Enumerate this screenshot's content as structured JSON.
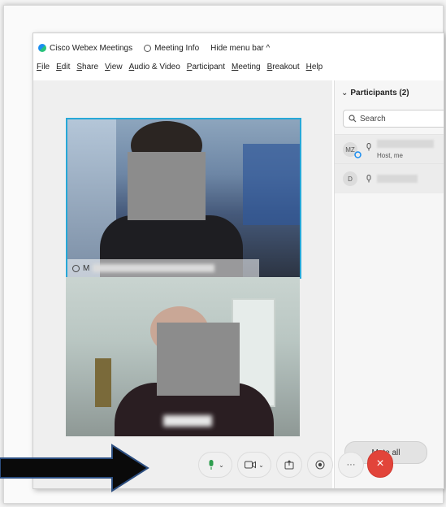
{
  "window": {
    "app_title": "Cisco Webex Meetings",
    "meeting_info": "Meeting Info",
    "hide_menu": "Hide menu bar ^"
  },
  "menu": [
    "File",
    "Edit",
    "Share",
    "View",
    "Audio & Video",
    "Participant",
    "Meeting",
    "Breakout",
    "Help"
  ],
  "participants_panel": {
    "title": "Participants (2)",
    "search_placeholder": "Search",
    "participants": [
      {
        "initials": "MZ",
        "role": "Host, me"
      },
      {
        "initials": "D",
        "role": ""
      }
    ],
    "mute_all_label": "Mute all"
  },
  "video": {
    "tile1_name": "M"
  },
  "controls": {
    "mic_icon": "mic-icon",
    "video_icon": "video-icon",
    "share_icon": "share-icon",
    "record_icon": "record-icon",
    "more_label": "···",
    "end_label": "×",
    "end_color": "#e2443a",
    "mic_color": "#2f9e4f"
  },
  "colors": {
    "active_speaker_border": "#27a8d8",
    "arrow_fill": "#0a0a0a",
    "arrow_outline": "#2c4e80"
  }
}
